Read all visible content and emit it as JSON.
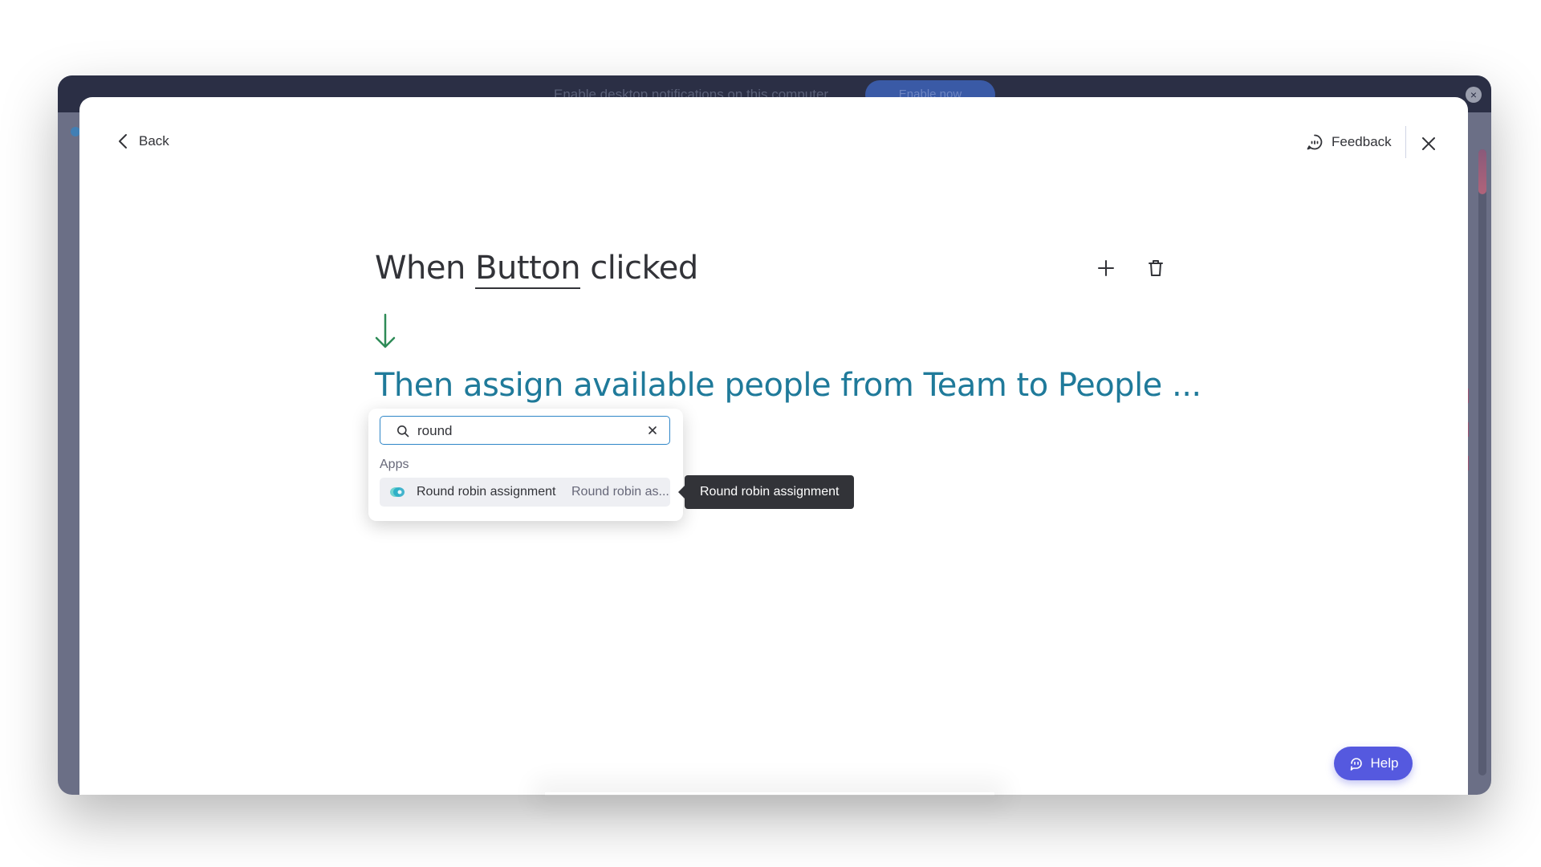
{
  "notification": {
    "text": "Enable desktop notifications on this computer",
    "button_label": "Enable now",
    "close_glyph": "×"
  },
  "header": {
    "back_label": "Back",
    "feedback_label": "Feedback"
  },
  "automation": {
    "trigger": {
      "prefix": "When",
      "token": "Button",
      "suffix": "clicked"
    },
    "action_text": "Then assign available people from Team to People ..."
  },
  "search": {
    "value": "round",
    "section_label": "Apps",
    "results": [
      {
        "name": "Round robin assignment",
        "description": "Round robin as...",
        "icon": "round-robin-app-logo"
      }
    ]
  },
  "tooltip": {
    "text": "Round robin assignment"
  },
  "help": {
    "label": "Help"
  },
  "colors": {
    "accent": "#2f86c8",
    "action_text": "#1f7a9a",
    "flow_arrow": "#2e8b57",
    "help_button": "#5559df",
    "tooltip_bg": "#323338"
  },
  "icons": [
    "chevron-left-icon",
    "feedback-icon",
    "close-icon",
    "plus-icon",
    "trash-icon",
    "arrow-down-icon",
    "search-icon",
    "clear-icon",
    "help-icon"
  ]
}
